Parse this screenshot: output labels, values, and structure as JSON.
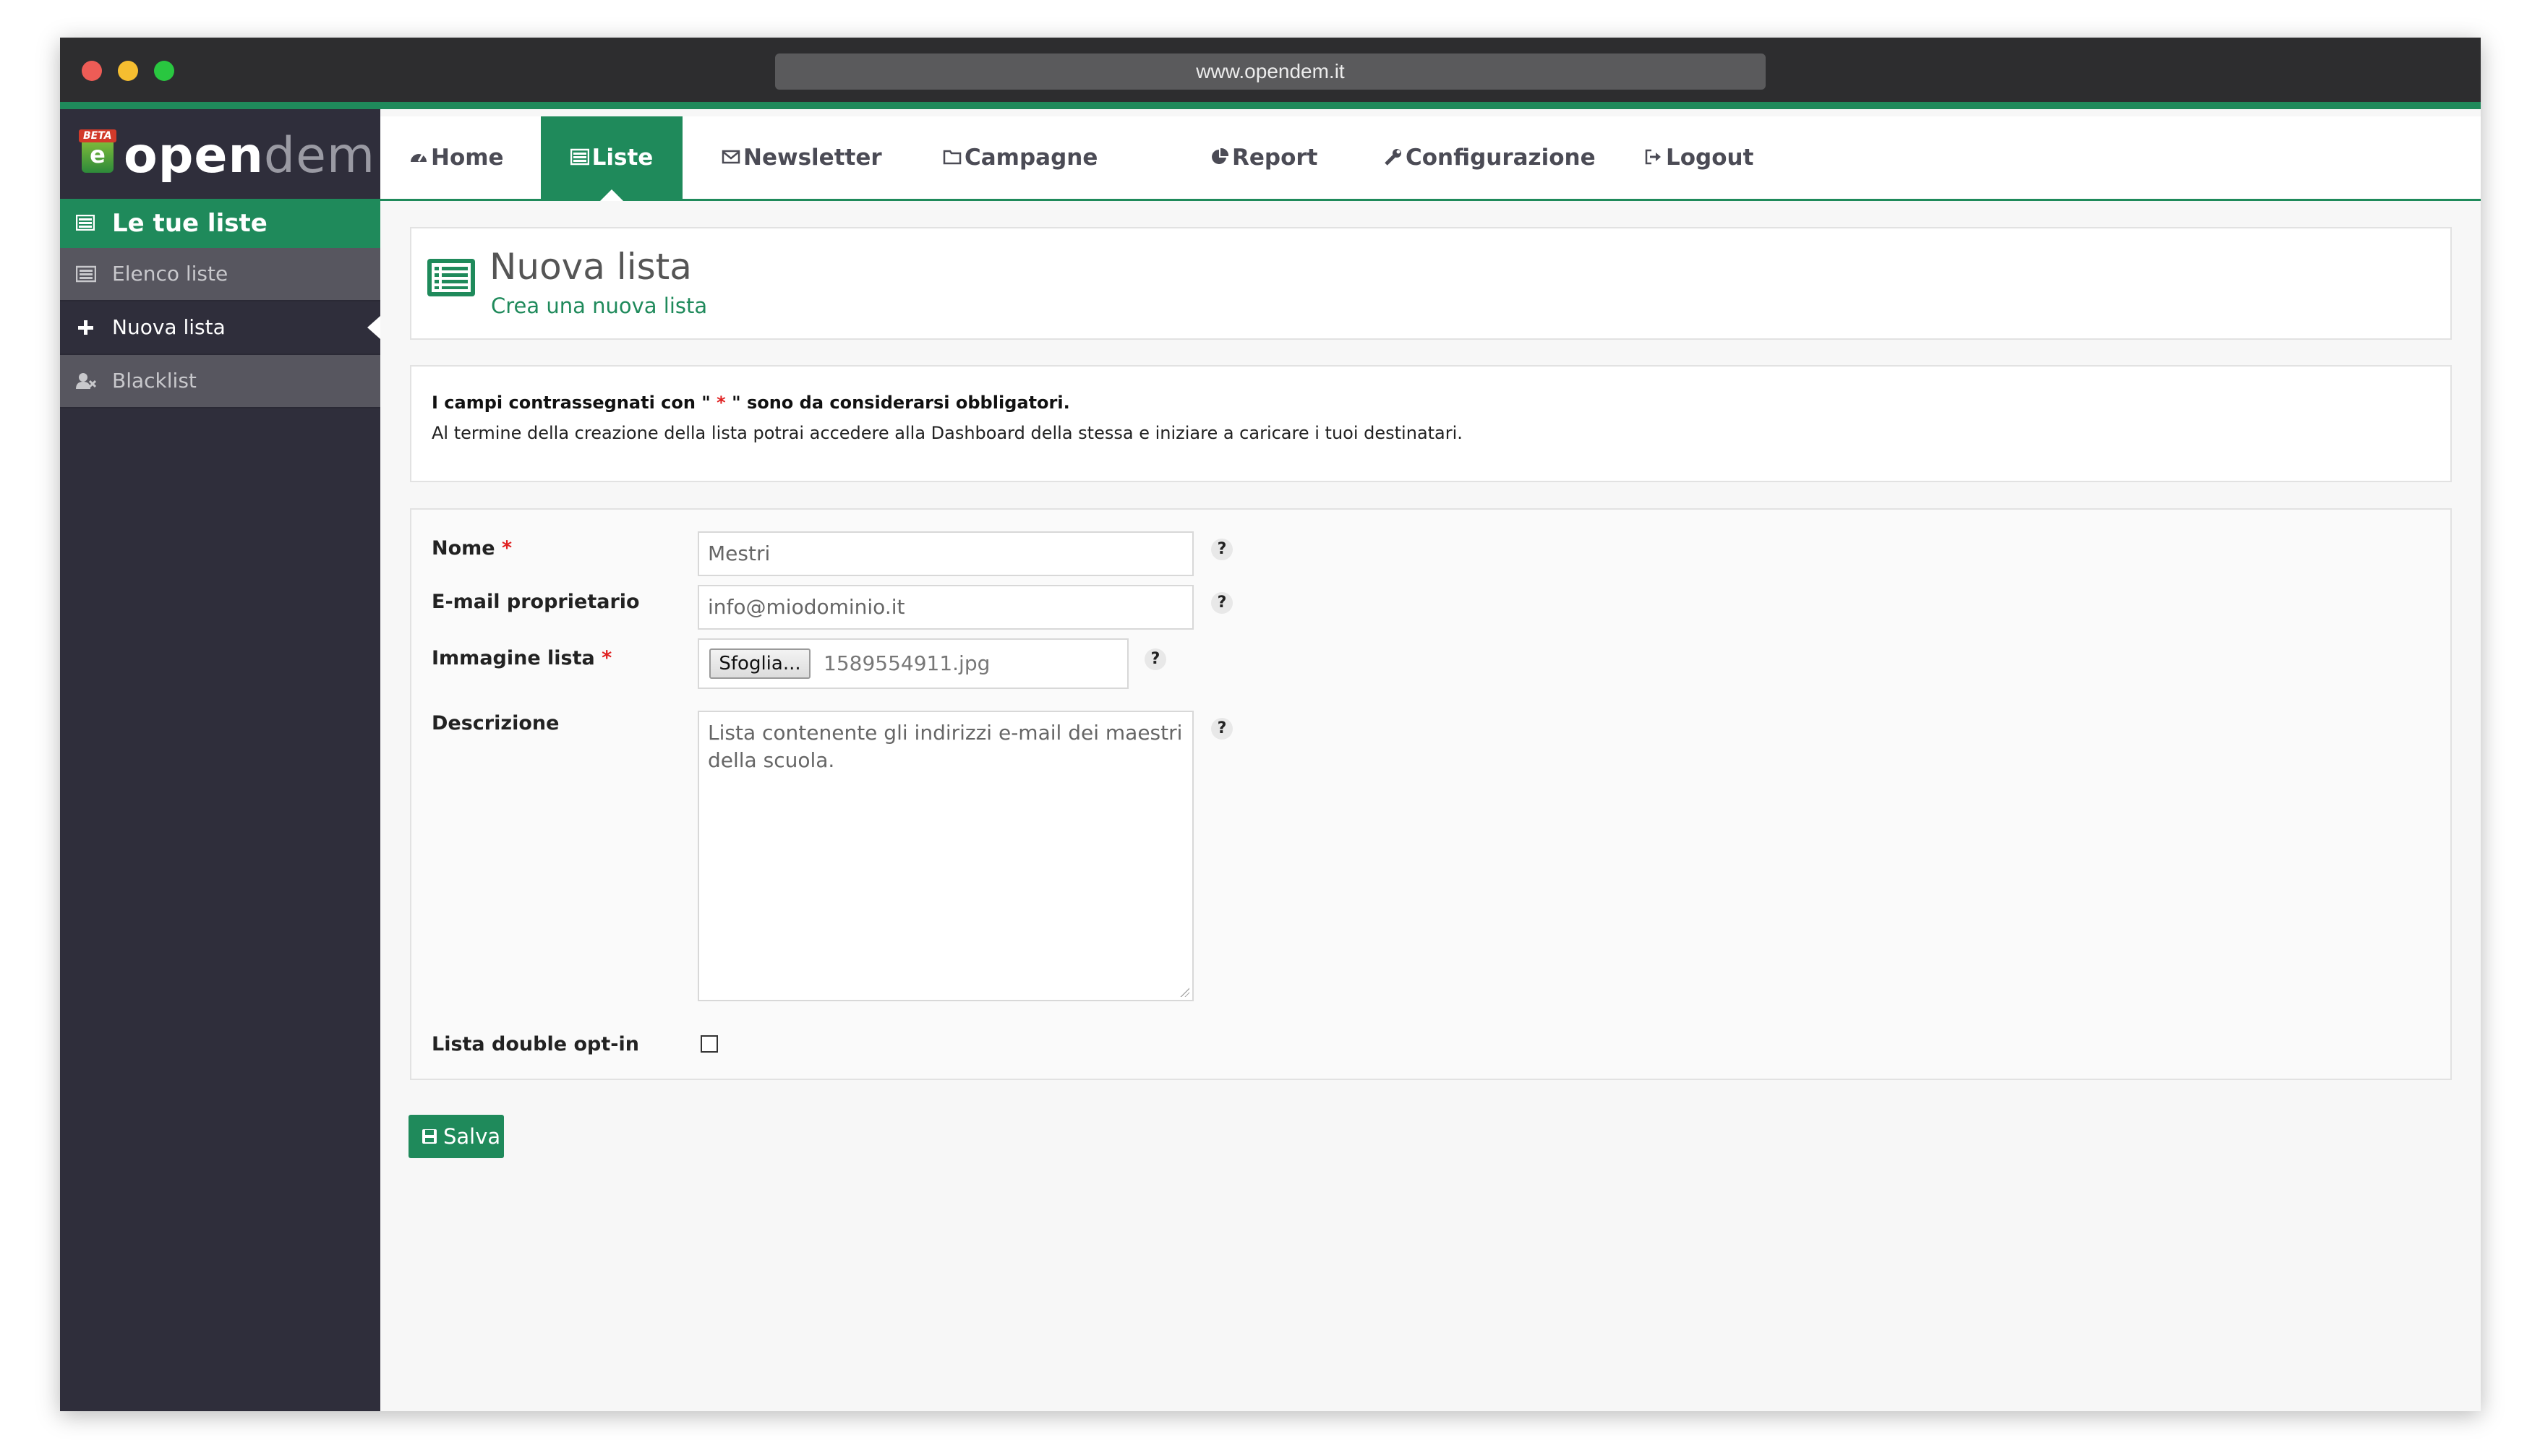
{
  "browser": {
    "url": "www.opendem.it"
  },
  "logo": {
    "badge": "BETA",
    "text_open": "open",
    "text_dem": "dem"
  },
  "sidebar": {
    "header": "Le tue liste",
    "items": [
      {
        "label": "Elenco liste",
        "icon": "list-icon"
      },
      {
        "label": "Nuova lista",
        "icon": "plus-icon"
      },
      {
        "label": "Blacklist",
        "icon": "user-block-icon"
      }
    ]
  },
  "nav": {
    "items": [
      {
        "label": "Home",
        "icon": "dashboard-icon"
      },
      {
        "label": "Liste",
        "icon": "list-icon"
      },
      {
        "label": "Newsletter",
        "icon": "envelope-icon"
      },
      {
        "label": "Campagne",
        "icon": "folder-icon"
      },
      {
        "label": "Report",
        "icon": "pie-chart-icon"
      },
      {
        "label": "Configurazione",
        "icon": "wrench-icon"
      },
      {
        "label": "Logout",
        "icon": "sign-out-icon"
      }
    ]
  },
  "page": {
    "title": "Nuova lista",
    "subtitle": "Crea una nuova lista"
  },
  "info": {
    "required_pre": "I campi contrassegnati con \" ",
    "required_star": "*",
    "required_post": " \" sono da considerarsi obbligatori.",
    "line2": "Al termine della creazione della lista potrai accedere alla Dashboard della stessa e iniziare a caricare i tuoi destinatari."
  },
  "form": {
    "name_label": "Nome",
    "name_value": "Mestri",
    "email_label": "E-mail proprietario",
    "email_value": "info@miodominio.it",
    "image_label": "Immagine lista",
    "browse_label": "Sfoglia...",
    "file_name": "1589554911.jpg",
    "description_label": "Descrizione",
    "description_value": "Lista contenente gli indirizzi e-mail dei maestri della scuola.",
    "double_optin_label": "Lista double opt-in",
    "double_optin_checked": false,
    "required_mark": "*",
    "help_glyph": "?"
  },
  "actions": {
    "save_label": "Salva"
  },
  "colors": {
    "accent": "#1f8a5b",
    "sidebar": "#2f2e3b",
    "required": "#e02020"
  }
}
